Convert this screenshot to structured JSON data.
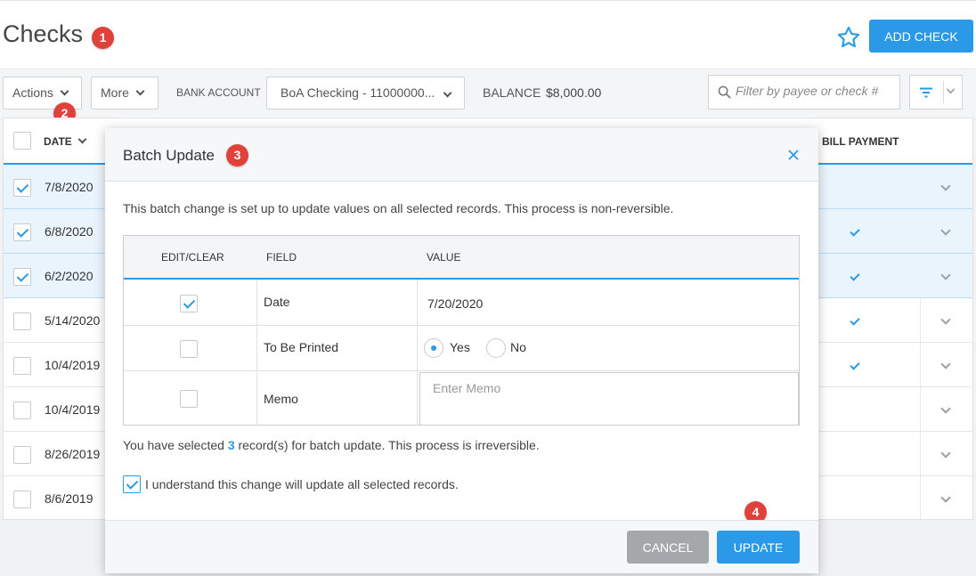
{
  "header": {
    "title": "Checks",
    "add_check_label": "ADD CHECK"
  },
  "badges": [
    "1",
    "2",
    "3",
    "4"
  ],
  "toolbar": {
    "actions_label": "Actions",
    "more_label": "More",
    "bank_account_label": "BANK ACCOUNT",
    "bank_account_value": "BoA Checking - 11000000...",
    "balance_label": "BALANCE",
    "balance_value": "$8,000.00",
    "search_placeholder": "Filter by payee or check #"
  },
  "table": {
    "columns": {
      "date": "DATE",
      "bill_payment": "BILL PAYMENT"
    },
    "rows": [
      {
        "date": "7/8/2020",
        "selected": true,
        "bill_payment": false
      },
      {
        "date": "6/8/2020",
        "selected": true,
        "bill_payment": true
      },
      {
        "date": "6/2/2020",
        "selected": true,
        "bill_payment": true
      },
      {
        "date": "5/14/2020",
        "selected": false,
        "bill_payment": true
      },
      {
        "date": "10/4/2019",
        "selected": false,
        "bill_payment": true
      },
      {
        "date": "10/4/2019",
        "selected": false,
        "bill_payment": false
      },
      {
        "date": "8/26/2019",
        "selected": false,
        "bill_payment": false
      },
      {
        "date": "8/6/2019",
        "selected": false,
        "bill_payment": false
      }
    ]
  },
  "modal": {
    "title": "Batch Update",
    "description": "This batch change is set up to update values on all selected records. This process is non-reversible.",
    "grid_headers": {
      "edit_clear": "EDIT/CLEAR",
      "field": "FIELD",
      "value": "VALUE"
    },
    "fields": {
      "date": {
        "label": "Date",
        "value": "7/20/2020",
        "checked": true
      },
      "to_be_printed": {
        "label": "To Be Printed",
        "yes": "Yes",
        "no": "No",
        "selected": "Yes",
        "checked": false
      },
      "memo": {
        "label": "Memo",
        "placeholder": "Enter Memo",
        "checked": false
      }
    },
    "selection_prefix": "You have selected",
    "selection_count": "3",
    "selection_suffix": "record(s) for batch update. This process is irreversible.",
    "acknowledge_label": "I understand this change will update all selected records.",
    "acknowledge_checked": true,
    "cancel_label": "CANCEL",
    "update_label": "UPDATE"
  },
  "colors": {
    "accent": "#2a9ae8",
    "badge": "#e0413a",
    "cancel": "#a5a8ab"
  }
}
